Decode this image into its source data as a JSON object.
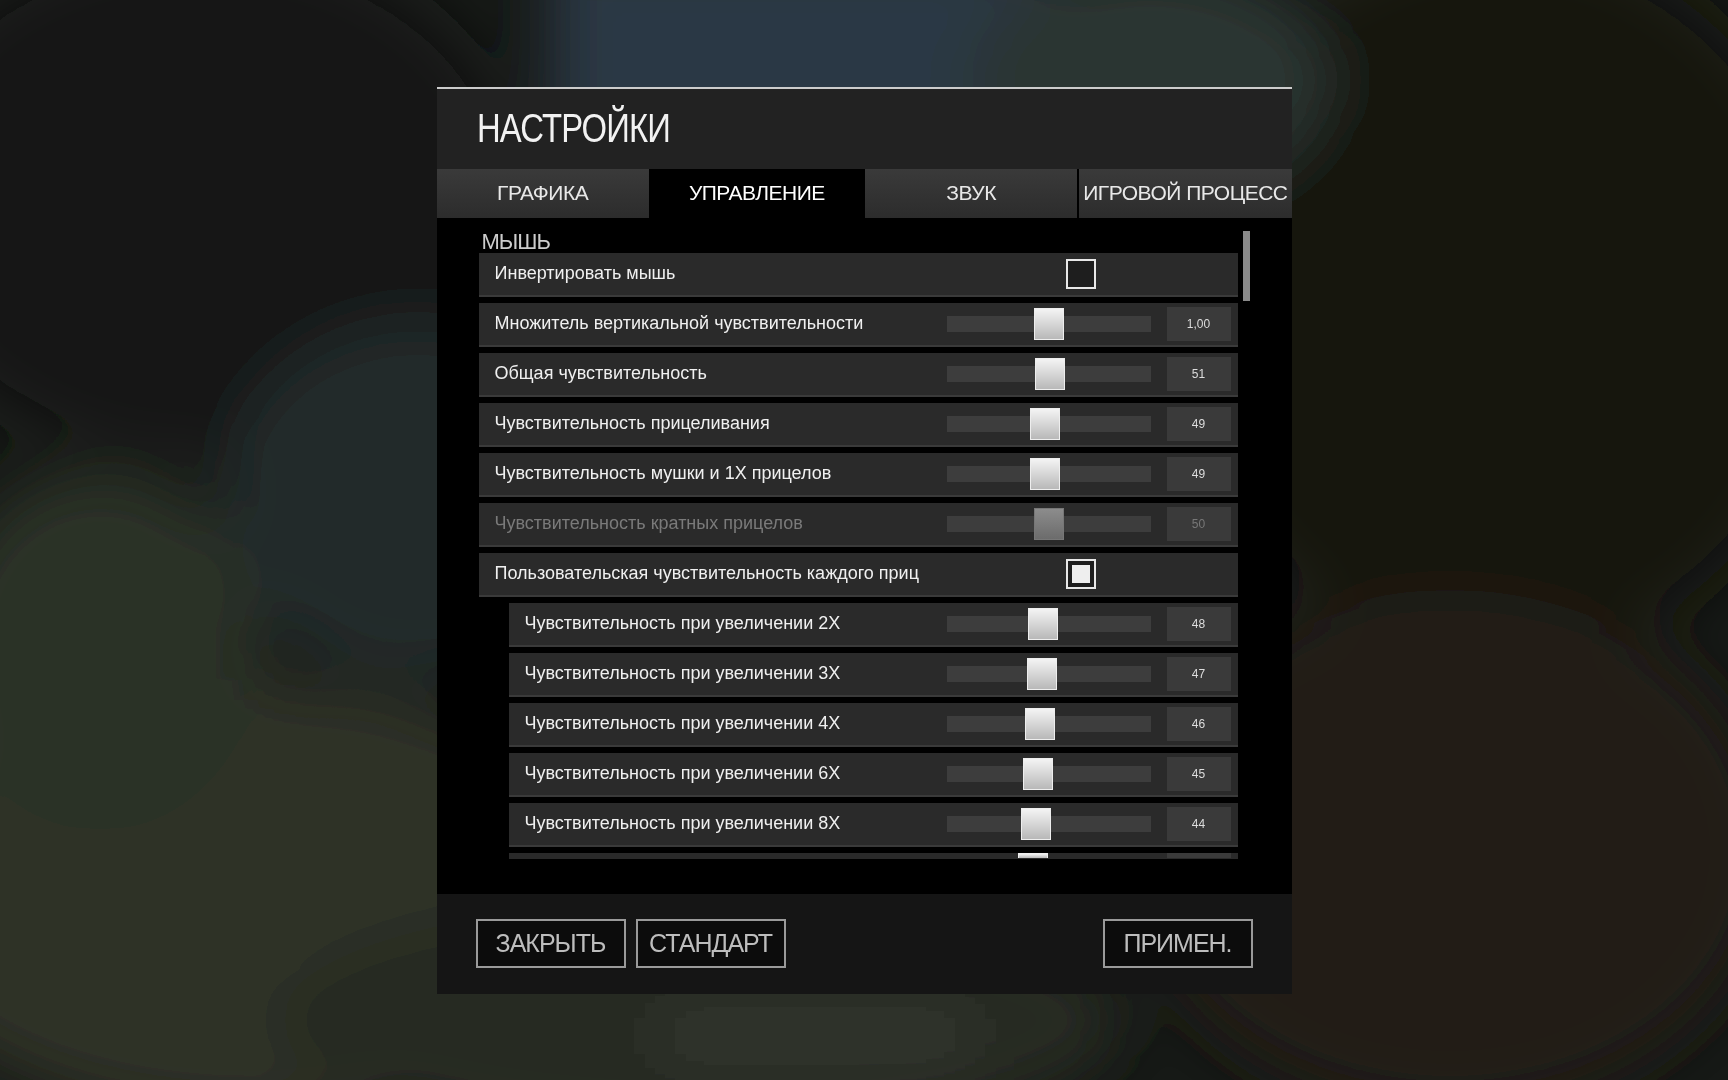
{
  "window": {
    "title": "НАСТРОЙКИ"
  },
  "tabs": [
    {
      "label": "ГРАФИКА",
      "selected": false
    },
    {
      "label": "УПРАВЛЕНИЕ",
      "selected": true
    },
    {
      "label": "ЗВУК",
      "selected": false
    },
    {
      "label": "ИГРОВОЙ ПРОЦЕСС",
      "selected": false
    }
  ],
  "section": {
    "title": "МЫШЬ"
  },
  "settings": [
    {
      "kind": "checkbox",
      "label": "Инвертировать мышь",
      "checked": false
    },
    {
      "kind": "slider",
      "label": "Множитель вертикальной чувствительности",
      "level": 0.5,
      "value": "1,00",
      "disabled": false
    },
    {
      "kind": "slider",
      "label": "Общая чувствительность",
      "level": 0.51,
      "value": "51",
      "disabled": false
    },
    {
      "kind": "slider",
      "label": "Чувствительность прицеливания",
      "level": 0.48,
      "value": "49",
      "disabled": false
    },
    {
      "kind": "slider",
      "label": "Чувствительность мушки и 1X прицелов",
      "level": 0.48,
      "value": "49",
      "disabled": false
    },
    {
      "kind": "slider",
      "label": "Чувствительность кратных прицелов",
      "level": 0.5,
      "value": "50",
      "disabled": true
    },
    {
      "kind": "checkbox",
      "label": "Пользовательская чувствительность каждого приц",
      "checked": true,
      "children": [
        {
          "kind": "slider",
          "label": "Чувствительность при увеличении 2X",
          "level": 0.47,
          "value": "48",
          "disabled": false
        },
        {
          "kind": "slider",
          "label": "Чувствительность при увеличении 3X",
          "level": 0.46,
          "value": "47",
          "disabled": false
        },
        {
          "kind": "slider",
          "label": "Чувствительность при увеличении 4X",
          "level": 0.45,
          "value": "46",
          "disabled": false
        },
        {
          "kind": "slider",
          "label": "Чувствительность при увеличении 6X",
          "level": 0.44,
          "value": "45",
          "disabled": false
        },
        {
          "kind": "slider",
          "label": "Чувствительность при увеличении 8X",
          "level": 0.43,
          "value": "44",
          "disabled": false
        },
        {
          "kind": "slider",
          "level": 0.41,
          "disabled": false
        }
      ]
    }
  ],
  "buttons": [
    {
      "label": "ЗАКРЫТЬ"
    },
    {
      "label": "СТАНДАРТ"
    },
    {
      "label": "ПРИМЕН."
    }
  ]
}
